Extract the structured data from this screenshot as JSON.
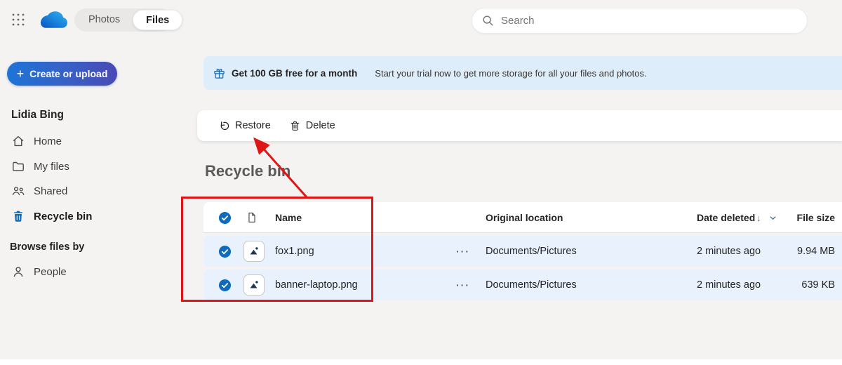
{
  "header": {
    "toggle": {
      "photos": "Photos",
      "files": "Files"
    },
    "search": {
      "placeholder": "Search"
    }
  },
  "sidebar": {
    "create_button": "Create or upload",
    "user_name": "Lidia Bing",
    "items": [
      {
        "label": "Home"
      },
      {
        "label": "My files"
      },
      {
        "label": "Shared"
      },
      {
        "label": "Recycle bin"
      }
    ],
    "browse_header": "Browse files by",
    "browse_items": [
      {
        "label": "People"
      }
    ]
  },
  "banner": {
    "title": "Get 100 GB free for a month",
    "subtitle": "Start your trial now to get more storage for all your files and photos."
  },
  "toolbar": {
    "restore": "Restore",
    "delete": "Delete"
  },
  "page_title": "Recycle bin",
  "table": {
    "headers": {
      "name": "Name",
      "location": "Original location",
      "date": "Date deleted",
      "size": "File size"
    },
    "rows": [
      {
        "name": "fox1.png",
        "location": "Documents/Pictures",
        "date": "2 minutes ago",
        "size": "9.94 MB"
      },
      {
        "name": "banner-laptop.png",
        "location": "Documents/Pictures",
        "date": "2 minutes ago",
        "size": "639 KB"
      }
    ]
  },
  "icons": {
    "more": "···",
    "sort_desc": "↓",
    "plus": "+"
  },
  "colors": {
    "accent_blue": "#0f6cbd",
    "selected_row": "#e9f2fc",
    "banner_bg": "#ddedf9",
    "annotation_red": "#e01616",
    "create_gradient_start": "#1e74d6",
    "create_gradient_end": "#4a49b4"
  }
}
